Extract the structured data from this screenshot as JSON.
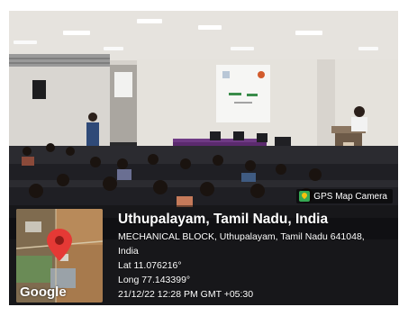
{
  "stamp": {
    "app_label": "GPS Map Camera",
    "app_icon": "gps-map-camera-icon",
    "location_title": "Uthupalayam, Tamil Nadu, India",
    "address_line1": "MECHANICAL BLOCK, Uthupalayam, Tamil Nadu 641048,",
    "address_line2": "India",
    "latitude": "Lat 11.076216°",
    "longitude": "Long 77.143399°",
    "datetime": "21/12/22 12:28 PM GMT +05:30"
  },
  "map": {
    "provider_label": "Google",
    "marker_icon": "map-pin-icon",
    "marker_color": "#e53935"
  },
  "colors": {
    "overlay": "#000000",
    "text": "#ffffff",
    "accent_green": "#35a853"
  }
}
